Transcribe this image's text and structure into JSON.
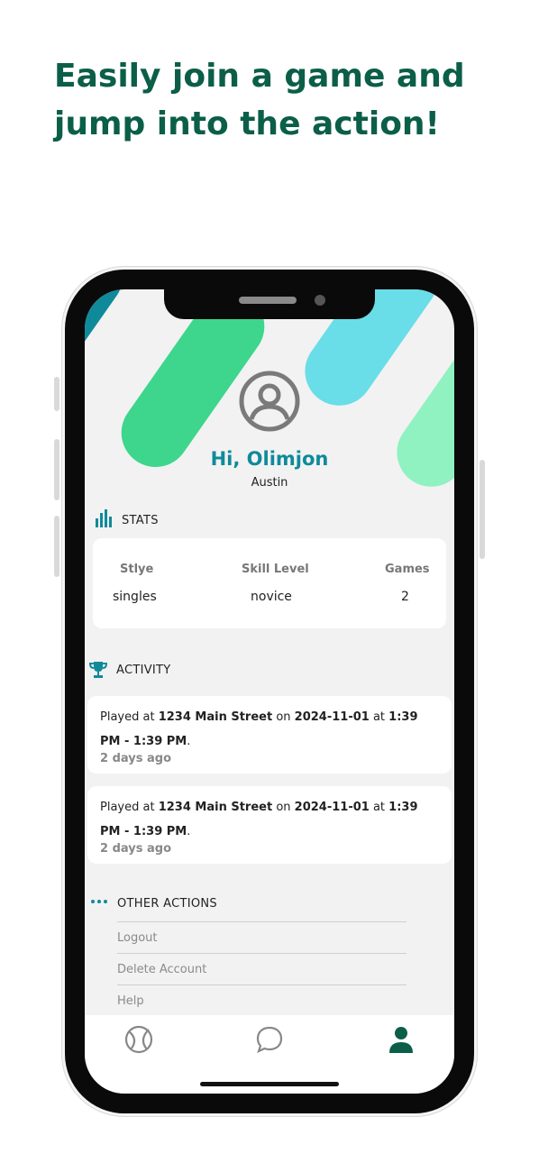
{
  "headline": "Easily join a game and jump into the action!",
  "profile": {
    "greeting": "Hi, Olimjon",
    "location": "Austin",
    "avatar_icon": "user-circle-icon"
  },
  "stats": {
    "title": "STATS",
    "icon": "bar-chart-icon",
    "columns": [
      {
        "label": "Stlye",
        "value": "singles"
      },
      {
        "label": "Skill Level",
        "value": "novice"
      },
      {
        "label": "Games",
        "value": "2"
      }
    ]
  },
  "activity": {
    "title": "ACTIVITY",
    "icon": "trophy-icon",
    "items": [
      {
        "prefix": "Played at ",
        "place": "1234 Main Street",
        "mid1": " on ",
        "date": "2024-11-01",
        "mid2": " at ",
        "start": "1:39 PM",
        "dash": " - ",
        "end": "1:39 PM",
        "suffix": ".",
        "ago": "2 days ago"
      },
      {
        "prefix": "Played at ",
        "place": "1234 Main Street",
        "mid1": " on ",
        "date": "2024-11-01",
        "mid2": " at ",
        "start": "1:39 PM",
        "dash": " - ",
        "end": "1:39 PM",
        "suffix": ".",
        "ago": "2 days ago"
      }
    ]
  },
  "other_actions": {
    "title": "OTHER ACTIONS",
    "icon": "more-dots-icon",
    "items": [
      "Logout",
      "Delete Account",
      "Help"
    ]
  },
  "tabbar": {
    "tabs": [
      "tennis-ball-icon",
      "chat-bubble-icon",
      "profile-icon"
    ],
    "active": "profile-icon"
  },
  "colors": {
    "accent_green": "#0b5e48",
    "teal": "#0f8a9a",
    "stripe_green": "#3dd68c",
    "stripe_cyan": "#69dde8",
    "stripe_mint": "#8ff2c0",
    "stripe_teal": "#0f8a9a"
  }
}
